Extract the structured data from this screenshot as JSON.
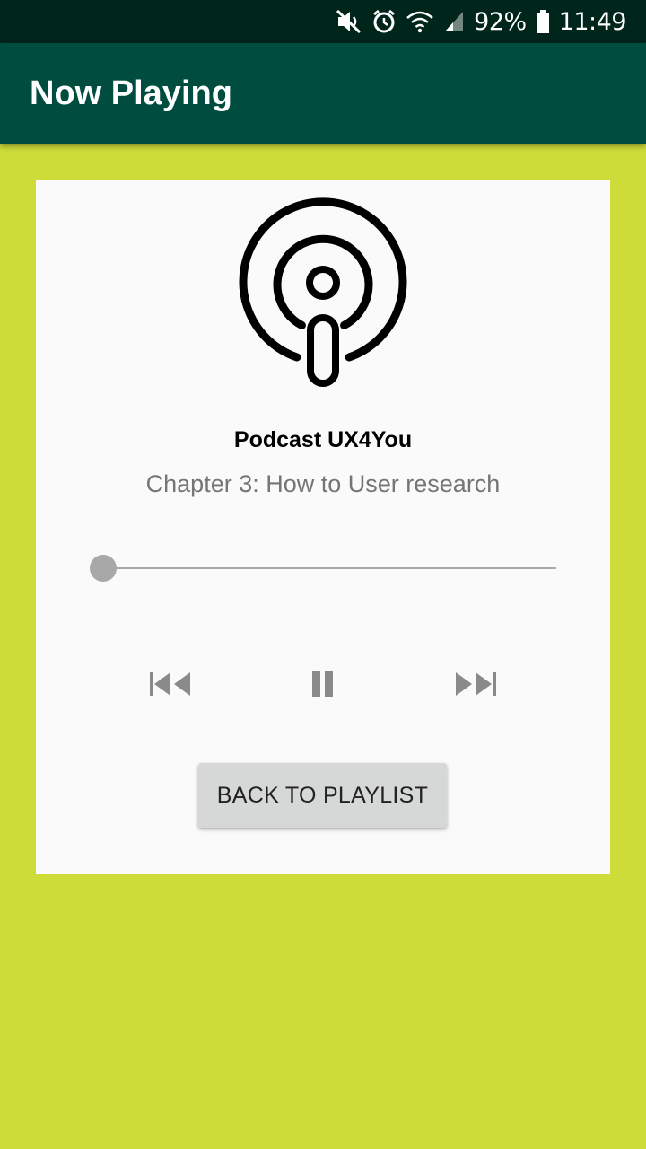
{
  "status_bar": {
    "battery": "92%",
    "time": "11:49",
    "icons": [
      "mute-icon",
      "alarm-icon",
      "wifi-icon",
      "signal-icon",
      "battery-icon"
    ]
  },
  "app_bar": {
    "title": "Now Playing"
  },
  "player": {
    "logo_icon": "podcast-icon",
    "podcast_name": "Podcast UX4You",
    "episode": "Chapter 3: How to User research",
    "progress": 0,
    "controls": [
      "skip-previous-icon",
      "pause-icon",
      "skip-next-icon"
    ]
  },
  "back_button": {
    "label": "BACK TO PLAYLIST"
  },
  "colors": {
    "background": "#cddc39",
    "app_bar": "#004d40",
    "status_bar": "#00251a",
    "card": "#fafafa",
    "control_gray": "#a8a8a8"
  }
}
